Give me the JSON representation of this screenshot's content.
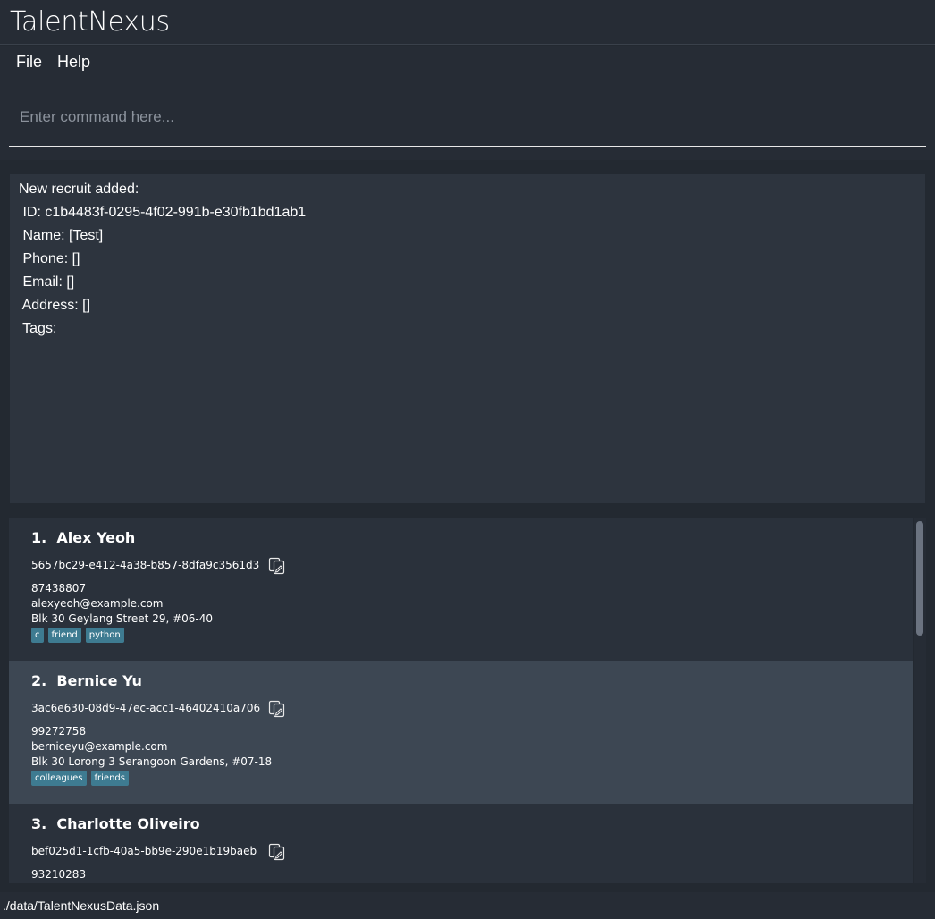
{
  "window": {
    "title": "TalentNexus"
  },
  "menu": {
    "file": "File",
    "help": "Help"
  },
  "command": {
    "placeholder": "Enter command here...",
    "value": ""
  },
  "result": {
    "lines": [
      "New recruit added:",
      " ID: c1b4483f-0295-4f02-991b-e30fb1bd1ab1",
      " Name: [Test]",
      " Phone: []",
      " Email: []",
      " Address: []",
      " Tags: "
    ]
  },
  "recruits": [
    {
      "index": "1.",
      "name": "Alex Yeoh",
      "id": "5657bc29-e412-4a38-b857-8dfa9c3561d3",
      "phone": "87438807",
      "email": "alexyeoh@example.com",
      "address": "Blk 30 Geylang Street 29, #06-40",
      "tags": [
        "c",
        "friend",
        "python"
      ]
    },
    {
      "index": "2.",
      "name": "Bernice Yu",
      "id": "3ac6e630-08d9-47ec-acc1-46402410a706",
      "phone": "99272758",
      "email": "berniceyu@example.com",
      "address": "Blk 30 Lorong 3 Serangoon Gardens, #07-18",
      "tags": [
        "colleagues",
        "friends"
      ]
    },
    {
      "index": "3.",
      "name": "Charlotte Oliveiro",
      "id": "bef025d1-1cfb-40a5-bb9e-290e1b19baeb",
      "phone": "93210283",
      "email": "",
      "address": "",
      "tags": []
    }
  ],
  "status": {
    "path": "./data/TalentNexusData.json"
  },
  "colors": {
    "tag": "#3e7b91",
    "selected_card": "#3d4753",
    "card": "#2a313b"
  },
  "icons": {
    "copy": "copy-icon"
  }
}
